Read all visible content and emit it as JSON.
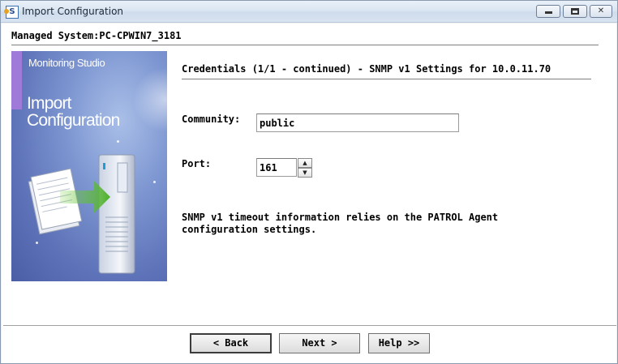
{
  "window": {
    "title": "Import Configuration",
    "icon_name": "app-icon",
    "app_icon_glyph": "S"
  },
  "header": {
    "managed_system": "Managed System:PC-CPWIN7_3181"
  },
  "banner": {
    "brand": "Monitoring Studio",
    "heading_line1": "Import",
    "heading_line2": "Configuration"
  },
  "content": {
    "title": "Credentials (1/1 - continued) - SNMP v1 Settings for 10.0.11.70",
    "community_label": "Community:",
    "community_value": "public",
    "port_label": "Port:",
    "port_value": "161",
    "info_line1": "SNMP v1 timeout information relies on the PATROL Agent",
    "info_line2": "configuration settings."
  },
  "buttons": {
    "back": "< Back",
    "next": "Next >",
    "help": "Help >>"
  },
  "colors": {
    "banner_purple": "#a07ad8",
    "banner_blue": "#5d72b8",
    "titlebar": "#dbe6f3"
  }
}
